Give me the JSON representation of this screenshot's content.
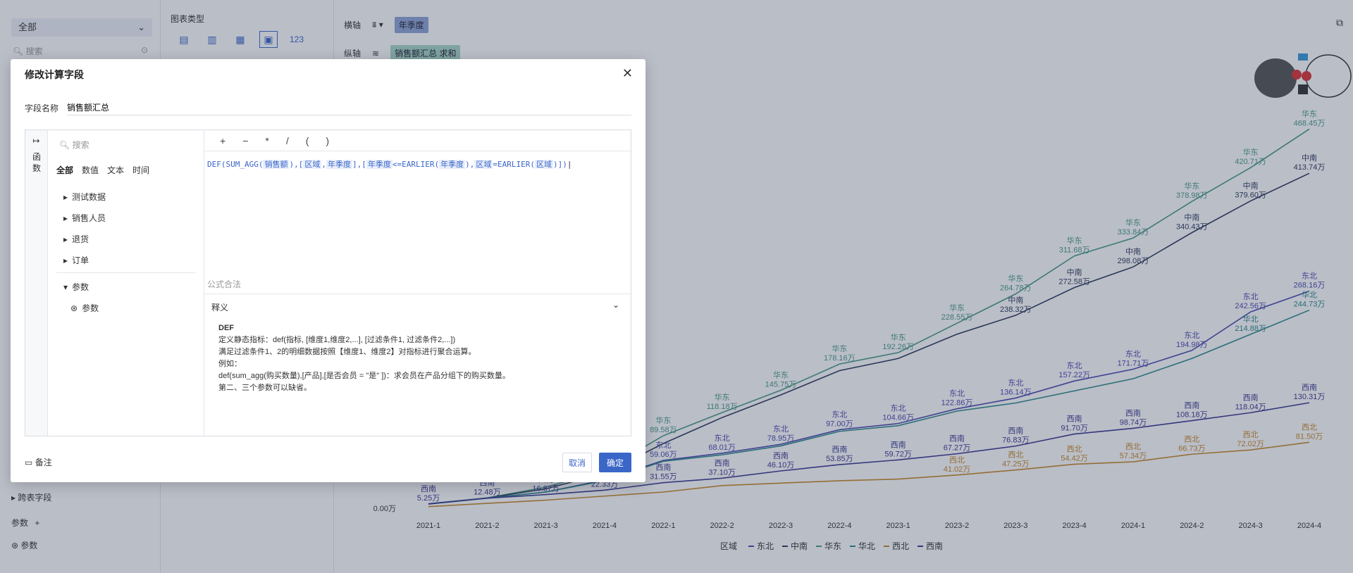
{
  "left_panel": {
    "combo": "全部",
    "search_placeholder": "搜索",
    "cross_table": "跨表字段",
    "param_header": "参数",
    "param_item": "参数"
  },
  "mid_panel": {
    "chart_types_label": "图表类型",
    "chart_type_icons": [
      "table-icon",
      "cross-table-icon",
      "detail-table-icon",
      "custom-chart-icon",
      "kpi-icon"
    ],
    "kpi_label": "123"
  },
  "axis": {
    "x_label": "横轴",
    "x_field": "年季度",
    "y_label": "纵轴",
    "y_field": "销售额汇总",
    "y_agg": "求和"
  },
  "modal": {
    "title": "修改计算字段",
    "field_name_label": "字段名称",
    "field_name_value": "销售额汇总",
    "fn_tab": "函数",
    "tree_search_placeholder": "搜索",
    "filter_tabs": [
      "全部",
      "数值",
      "文本",
      "时间"
    ],
    "tree": {
      "items": [
        "测试数据",
        "销售人员",
        "退货",
        "订单"
      ],
      "param_group": "参数",
      "param_item": "参数"
    },
    "operators": [
      "+",
      "−",
      "*",
      "/",
      "(",
      ")"
    ],
    "formula": {
      "p1": "DEF(SUM_AGG(",
      "f1": "销售额",
      "p2": "),[",
      "f2": "区域",
      "p3": ",",
      "f3": "年季度",
      "p4": "],[",
      "f4": "年季度",
      "p5": "<=EARLIER(",
      "f5": "年季度",
      "p6": "),",
      "f6": "区域",
      "p7": "=EARLIER(",
      "f7": "区域",
      "p8": ")])"
    },
    "formula_hint": "公式合法",
    "doc": {
      "title": "释义",
      "fn": "DEF",
      "line1": "定义静态指标：def(指标, [维度1,维度2,...], [过滤条件1, 过滤条件2,...])",
      "line2": "满足过滤条件1、2的明细数据按照【维度1、维度2】对指标进行聚合运算。",
      "line3": "例如：",
      "line4": "def(sum_agg(购买数量),[产品],[是否会员 = \"是\" ])：求会员在产品分组下的购买数量。",
      "line5": "第二、三个参数可以缺省。"
    },
    "note": "备注",
    "cancel": "取消",
    "ok": "确定"
  },
  "chart_data": {
    "type": "line",
    "categories": [
      "2021-1",
      "2021-2",
      "2021-3",
      "2021-4",
      "2022-1",
      "2022-2",
      "2022-3",
      "2022-4",
      "2023-1",
      "2023-2",
      "2023-3",
      "2023-4",
      "2024-1",
      "2024-2",
      "2024-3",
      "2024-4"
    ],
    "ylim": [
      0,
      480
    ],
    "y_tick_label": "0.00万",
    "legend_title": "区域",
    "series": [
      {
        "name": "华东",
        "color": "#4a9a8a",
        "values": [
          5.6,
          12.8,
          26,
          47,
          89.58,
          118.18,
          145.75,
          178.16,
          192.26,
          228.55,
          264.78,
          311.68,
          333.84,
          378.98,
          420.71,
          468.45
        ],
        "labels": [
          "",
          "",
          "",
          "",
          "89.58万",
          "118.18万",
          "145.75万",
          "178.16万",
          "192.26万",
          "228.55万",
          "264.78万",
          "311.68万",
          "333.84万",
          "378.98万",
          "420.71万",
          "468.45万"
        ]
      },
      {
        "name": "中南",
        "color": "#2c3a5c",
        "values": [
          5.4,
          12.6,
          24,
          43,
          80,
          112,
          140,
          170,
          185,
          215,
          238.32,
          272.58,
          298.08,
          340.43,
          379.6,
          413.74
        ],
        "labels": [
          "",
          "",
          "",
          "",
          "",
          "",
          "",
          "",
          "",
          "",
          "238.32万",
          "272.58万",
          "298.08万",
          "340.43万",
          "379.60万",
          "413.74万"
        ]
      },
      {
        "name": "东北",
        "color": "#4a4ab0",
        "values": [
          5.2,
          12.5,
          20,
          35,
          59.06,
          68.01,
          78.95,
          97.0,
          104.66,
          122.86,
          136.14,
          157.22,
          171.71,
          194.98,
          242.56,
          268.16
        ],
        "labels": [
          "",
          "",
          "",
          "",
          "59.06万",
          "68.01万",
          "78.95万",
          "97.00万",
          "104.66万",
          "122.86万",
          "136.14万",
          "157.22万",
          "171.71万",
          "194.98万",
          "242.56万",
          "268.16万"
        ]
      },
      {
        "name": "华北",
        "color": "#2c8a8a",
        "values": [
          5.3,
          12.4,
          20,
          34,
          58,
          66,
          77,
          95,
          102,
          120,
          130,
          145,
          160,
          185,
          214.88,
          244.73
        ],
        "labels": [
          "",
          "",
          "",
          "",
          "",
          "",
          "",
          "",
          "",
          "",
          "",
          "",
          "",
          "",
          "214.88万",
          "244.73万"
        ]
      },
      {
        "name": "西南",
        "color": "#3a3a90",
        "values": [
          5.25,
          12.48,
          16.87,
          22.33,
          31.55,
          37.1,
          46.1,
          53.85,
          59.72,
          67.27,
          76.83,
          91.7,
          98.74,
          108.18,
          118.04,
          130.31
        ],
        "labels": [
          "5.25万",
          "12.48万",
          "16.87万",
          "22.33万",
          "31.55万",
          "37.10万",
          "46.10万",
          "53.85万",
          "59.72万",
          "67.27万",
          "76.83万",
          "91.70万",
          "98.74万",
          "108.18万",
          "118.04万",
          "130.31万"
        ]
      },
      {
        "name": "西北",
        "color": "#c88a2a",
        "values": [
          2,
          6,
          10,
          15,
          20,
          28,
          31,
          34,
          36,
          41.02,
          47.25,
          54.42,
          57.34,
          66.73,
          72.02,
          81.5
        ],
        "labels": [
          "",
          "",
          "",
          "",
          "",
          "",
          "",
          "",
          "",
          "41.02万",
          "47.25万",
          "54.42万",
          "57.34万",
          "66.73万",
          "72.02万",
          "81.50万"
        ]
      }
    ]
  }
}
